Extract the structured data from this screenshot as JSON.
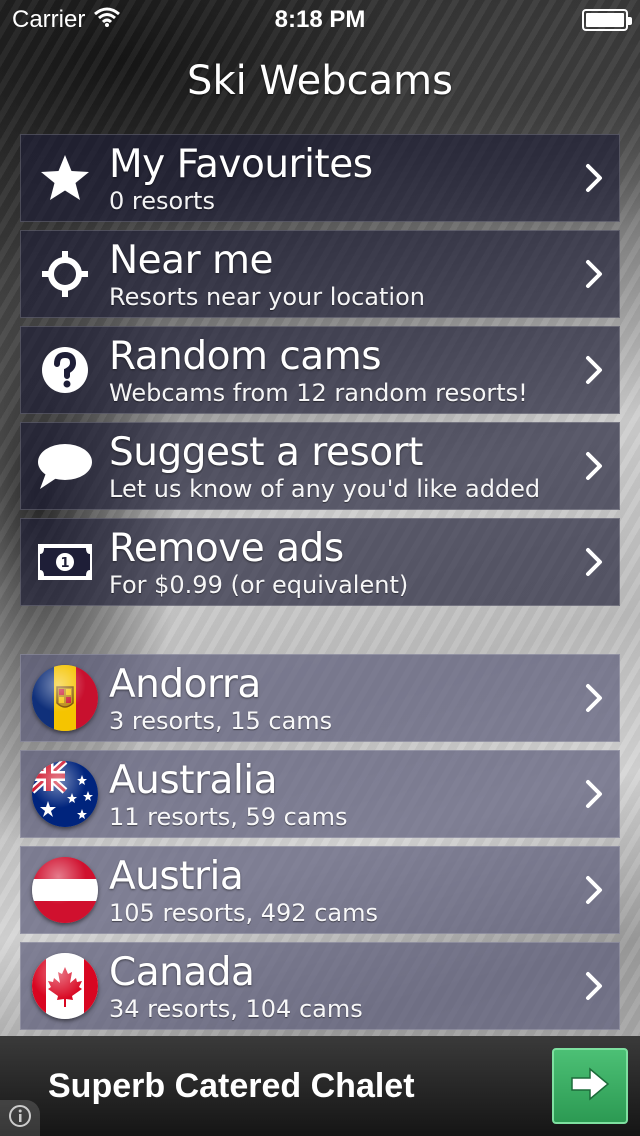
{
  "status_bar": {
    "carrier": "Carrier",
    "time": "8:18 PM"
  },
  "app_title": "Ski Webcams",
  "menu": [
    {
      "title": "My Favourites",
      "subtitle": "0 resorts",
      "icon": "star-icon"
    },
    {
      "title": "Near me",
      "subtitle": "Resorts near your location",
      "icon": "crosshair-icon"
    },
    {
      "title": "Random cams",
      "subtitle": "Webcams from 12 random resorts!",
      "icon": "question-icon"
    },
    {
      "title": "Suggest a resort",
      "subtitle": "Let us know of any you'd like added",
      "icon": "speech-bubble-icon"
    },
    {
      "title": "Remove ads",
      "subtitle": "For $0.99 (or equivalent)",
      "icon": "banknote-icon"
    }
  ],
  "countries": [
    {
      "name": "Andorra",
      "detail": "3 resorts, 15 cams",
      "flag": "andorra-flag-icon"
    },
    {
      "name": "Australia",
      "detail": "11 resorts, 59 cams",
      "flag": "australia-flag-icon"
    },
    {
      "name": "Austria",
      "detail": "105 resorts, 492 cams",
      "flag": "austria-flag-icon"
    },
    {
      "name": "Canada",
      "detail": "34 resorts, 104 cams",
      "flag": "canada-flag-icon"
    }
  ],
  "ad": {
    "text": "Superb Catered Chalet"
  },
  "colors": {
    "ad_button": "#3aae62",
    "menu_row": "#1e1e37",
    "country_row": "#5f5f7d"
  }
}
